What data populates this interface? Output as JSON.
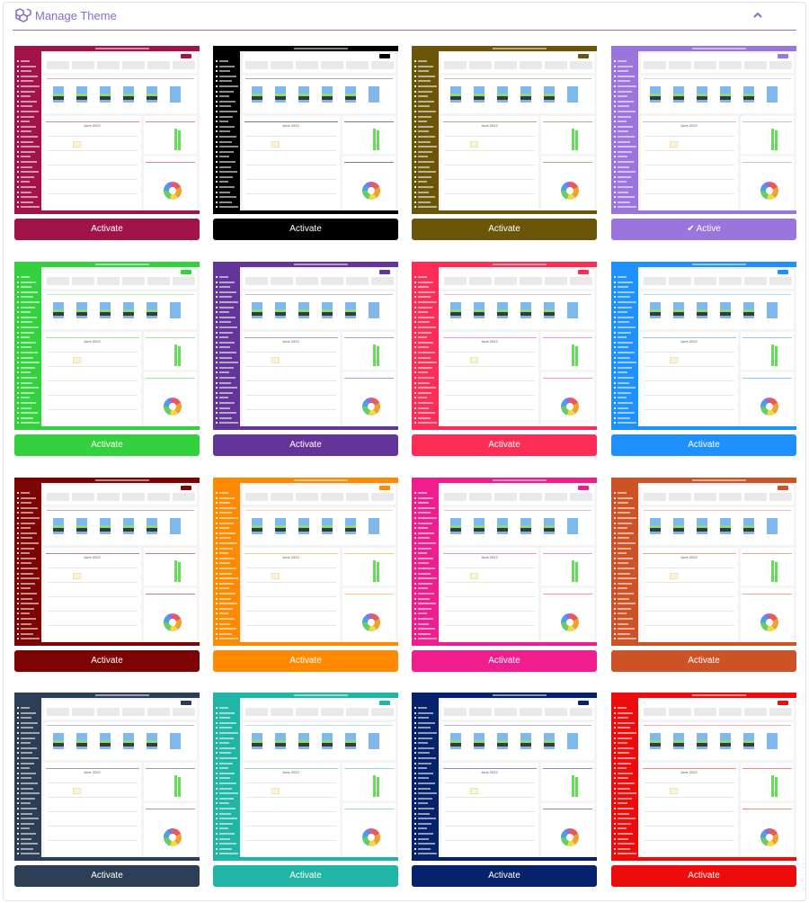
{
  "header": {
    "title": "Manage Theme",
    "icon": "cubes-icon",
    "toggle_icon": "chevron-up-icon"
  },
  "themes": [
    {
      "color": "#a2134a",
      "label": "Activate",
      "active": false
    },
    {
      "color": "#000000",
      "label": "Activate",
      "active": false
    },
    {
      "color": "#6b5508",
      "label": "Activate",
      "active": false
    },
    {
      "color": "#9a75de",
      "label": "Active",
      "active": true
    },
    {
      "color": "#33d13d",
      "label": "Activate",
      "active": false
    },
    {
      "color": "#633599",
      "label": "Activate",
      "active": false
    },
    {
      "color": "#ff2d55",
      "label": "Activate",
      "active": false
    },
    {
      "color": "#1e90ff",
      "label": "Activate",
      "active": false
    },
    {
      "color": "#7e0303",
      "label": "Activate",
      "active": false
    },
    {
      "color": "#ff8a00",
      "label": "Activate",
      "active": false
    },
    {
      "color": "#f01d8c",
      "label": "Activate",
      "active": false
    },
    {
      "color": "#cd5226",
      "label": "Activate",
      "active": false
    },
    {
      "color": "#2c3e55",
      "label": "Activate",
      "active": false
    },
    {
      "color": "#21b5a5",
      "label": "Activate",
      "active": false
    },
    {
      "color": "#05226b",
      "label": "Activate",
      "active": false
    },
    {
      "color": "#ee0b0b",
      "label": "Activate",
      "active": false
    }
  ],
  "thumbnail": {
    "calendar_title": "June 2022"
  }
}
